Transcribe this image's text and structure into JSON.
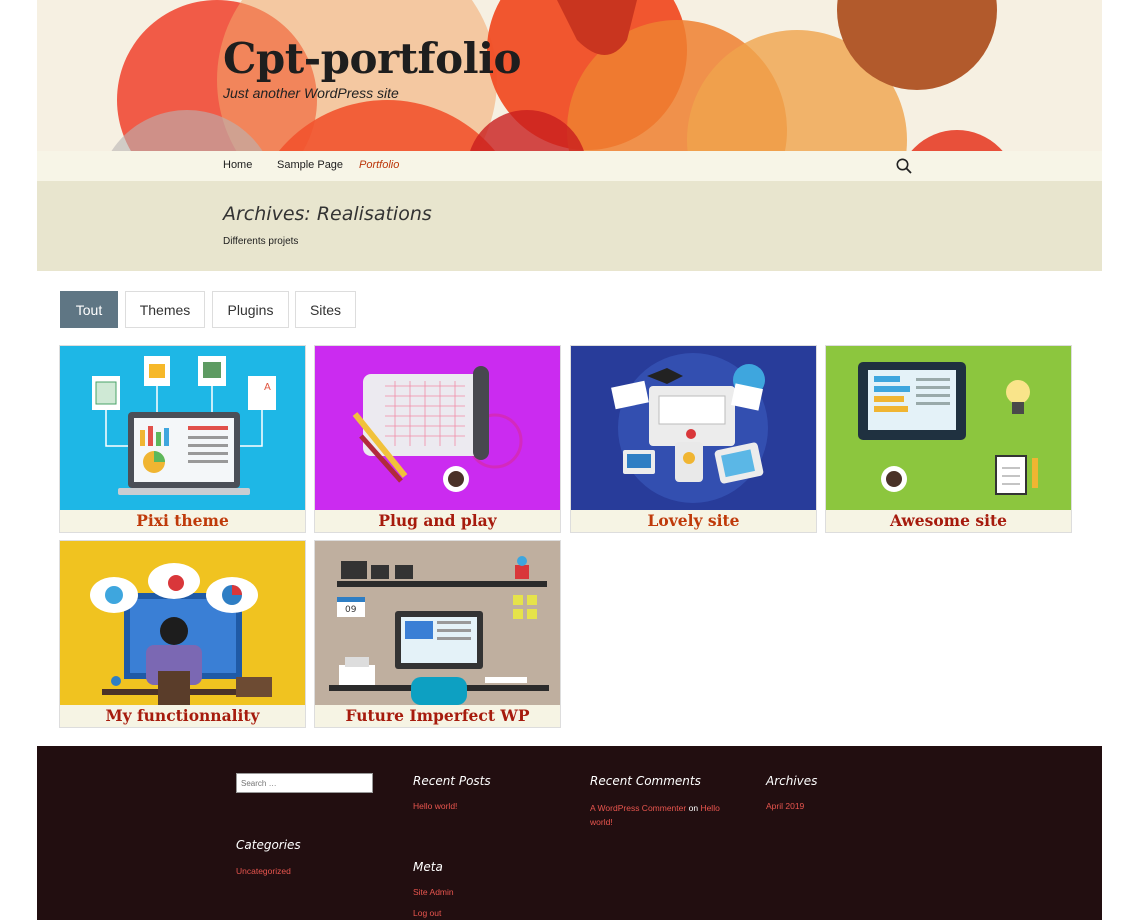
{
  "site": {
    "title": "Cpt-portfolio",
    "description": "Just another WordPress site"
  },
  "nav": {
    "items": [
      "Home",
      "Sample Page",
      "Portfolio"
    ],
    "current": "Portfolio"
  },
  "archive": {
    "title": "Archives: Realisations",
    "description": "Differents projets"
  },
  "filters": [
    "Tout",
    "Themes",
    "Plugins",
    "Sites"
  ],
  "active_filter": "Tout",
  "projects": [
    {
      "title": "Pixi theme",
      "color": "#bf3a0a"
    },
    {
      "title": "Plug and play",
      "color": "#a61b0d"
    },
    {
      "title": "Lovely site",
      "color": "#bf3a0a"
    },
    {
      "title": "Awesome site",
      "color": "#a61b0d"
    },
    {
      "title": "My functionnality",
      "color": "#a61b0d"
    },
    {
      "title": "Future Imperfect WP",
      "color": "#a61b0d"
    }
  ],
  "footer": {
    "search_placeholder": "Search …",
    "recent_posts": {
      "title": "Recent Posts",
      "items": [
        "Hello world!"
      ]
    },
    "recent_comments": {
      "title": "Recent Comments",
      "author": "A WordPress Commenter",
      "on": "on",
      "post": "Hello world!"
    },
    "archives": {
      "title": "Archives",
      "items": [
        "April 2019"
      ]
    },
    "categories": {
      "title": "Categories",
      "items": [
        "Uncategorized"
      ]
    },
    "meta": {
      "title": "Meta",
      "items": [
        "Site Admin",
        "Log out"
      ]
    }
  },
  "colors": {
    "accent": "#bc360a",
    "filter_active": "#5f7684",
    "footer_bg": "#220e10",
    "archive_bg": "#e8e5ce"
  }
}
